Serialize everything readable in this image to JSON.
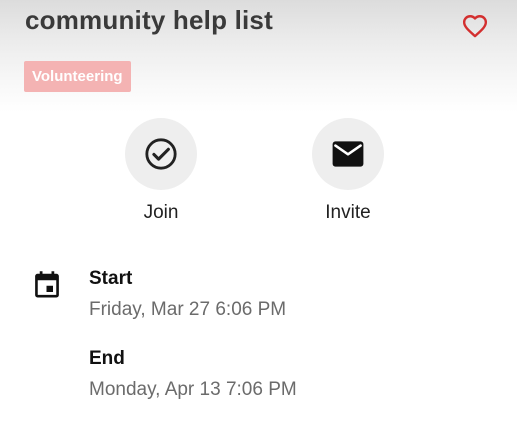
{
  "header": {
    "title": "community help list",
    "tag": "Volunteering"
  },
  "actions": [
    {
      "label": "Join",
      "icon": "check-circle-icon"
    },
    {
      "label": "Invite",
      "icon": "mail-icon"
    }
  ],
  "schedule": {
    "icon": "calendar-icon",
    "start": {
      "label": "Start",
      "value": "Friday, Mar 27 6:06 PM"
    },
    "end": {
      "label": "End",
      "value": "Monday, Apr 13 7:06 PM"
    }
  },
  "colors": {
    "accent": "#d32f2f",
    "tag_background": "#f4b3b3",
    "secondary_text": "#6b6b6b"
  }
}
